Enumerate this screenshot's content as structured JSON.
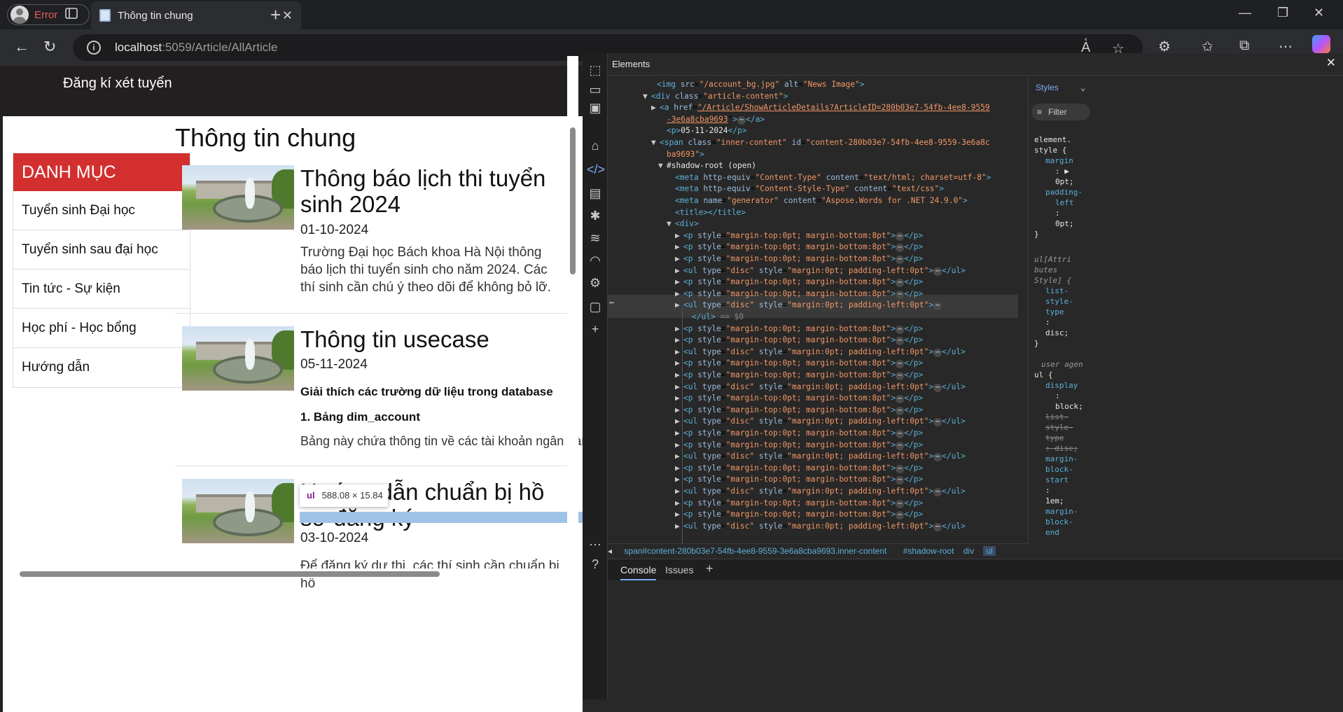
{
  "browser": {
    "profile_label": "Error",
    "tab_title": "Thông tin chung",
    "url_host": "localhost",
    "url_path": ":5059/Article/AllArticle"
  },
  "site": {
    "header_link": "Đăng kí xét tuyển",
    "sidebar_title": "DANH MỤC",
    "sidebar_items": [
      "Tuyển sinh Đại học",
      "Tuyển sinh sau đại học",
      "Tin tức - Sự kiện",
      "Học phí - Học bổng",
      "Hướng dẫn"
    ],
    "page_heading": "Thông tin chung",
    "articles": [
      {
        "title": "Thông báo lịch thi tuyển sinh 2024",
        "date": "01-10-2024",
        "desc": "Trường Đại học Bách khoa Hà Nội thông báo lịch thi tuyển sinh cho năm 2024. Các thí sinh cần chú ý theo dõi để không bỏ lỡ."
      },
      {
        "title": "Thông tin usecase",
        "date": "05-11-2024",
        "sub1": "Giải thích các trường dữ liệu trong database",
        "sub2": "1. Bảng dim_account",
        "desc": "Bảng này chứa thông tin về các tài khoản ngân hàng"
      },
      {
        "title": "Hướng dẫn chuẩn bị hồ sơ đăng ký",
        "date": "03-10-2024",
        "desc": "Để đăng ký dự thi, các thí sinh cần chuẩn bị hồ"
      }
    ],
    "inspect_tooltip": {
      "tag": "ul",
      "size": "588.08 × 15.84"
    }
  },
  "devtools": {
    "panel_title": "Elements",
    "styles_tab": "Styles",
    "filter_label": "Filter",
    "dom_lines": [
      {
        "i": 0,
        "html": "<span class='tag'>&lt;img</span> <span class='attr'>src</span>=<span class='val'>\"/account_bg.jpg\"</span> <span class='attr'>alt</span>=<span class='val'>\"News Image\"</span><span class='tag'>&gt;</span>"
      },
      {
        "i": 0,
        "tri": "▼",
        "html": "<span class='tag'>&lt;div</span> <span class='attr'>class</span>=<span class='val'>\"article-content\"</span><span class='tag'>&gt;</span>"
      }
    ],
    "breadcrumbs": [
      "span#content-280b03e7-54fb-4ee8-9559-3e6a8cba9693.inner-content",
      "#shadow-root",
      "div",
      "ul"
    ],
    "drawer_tabs": [
      "Console",
      "Issues"
    ]
  }
}
